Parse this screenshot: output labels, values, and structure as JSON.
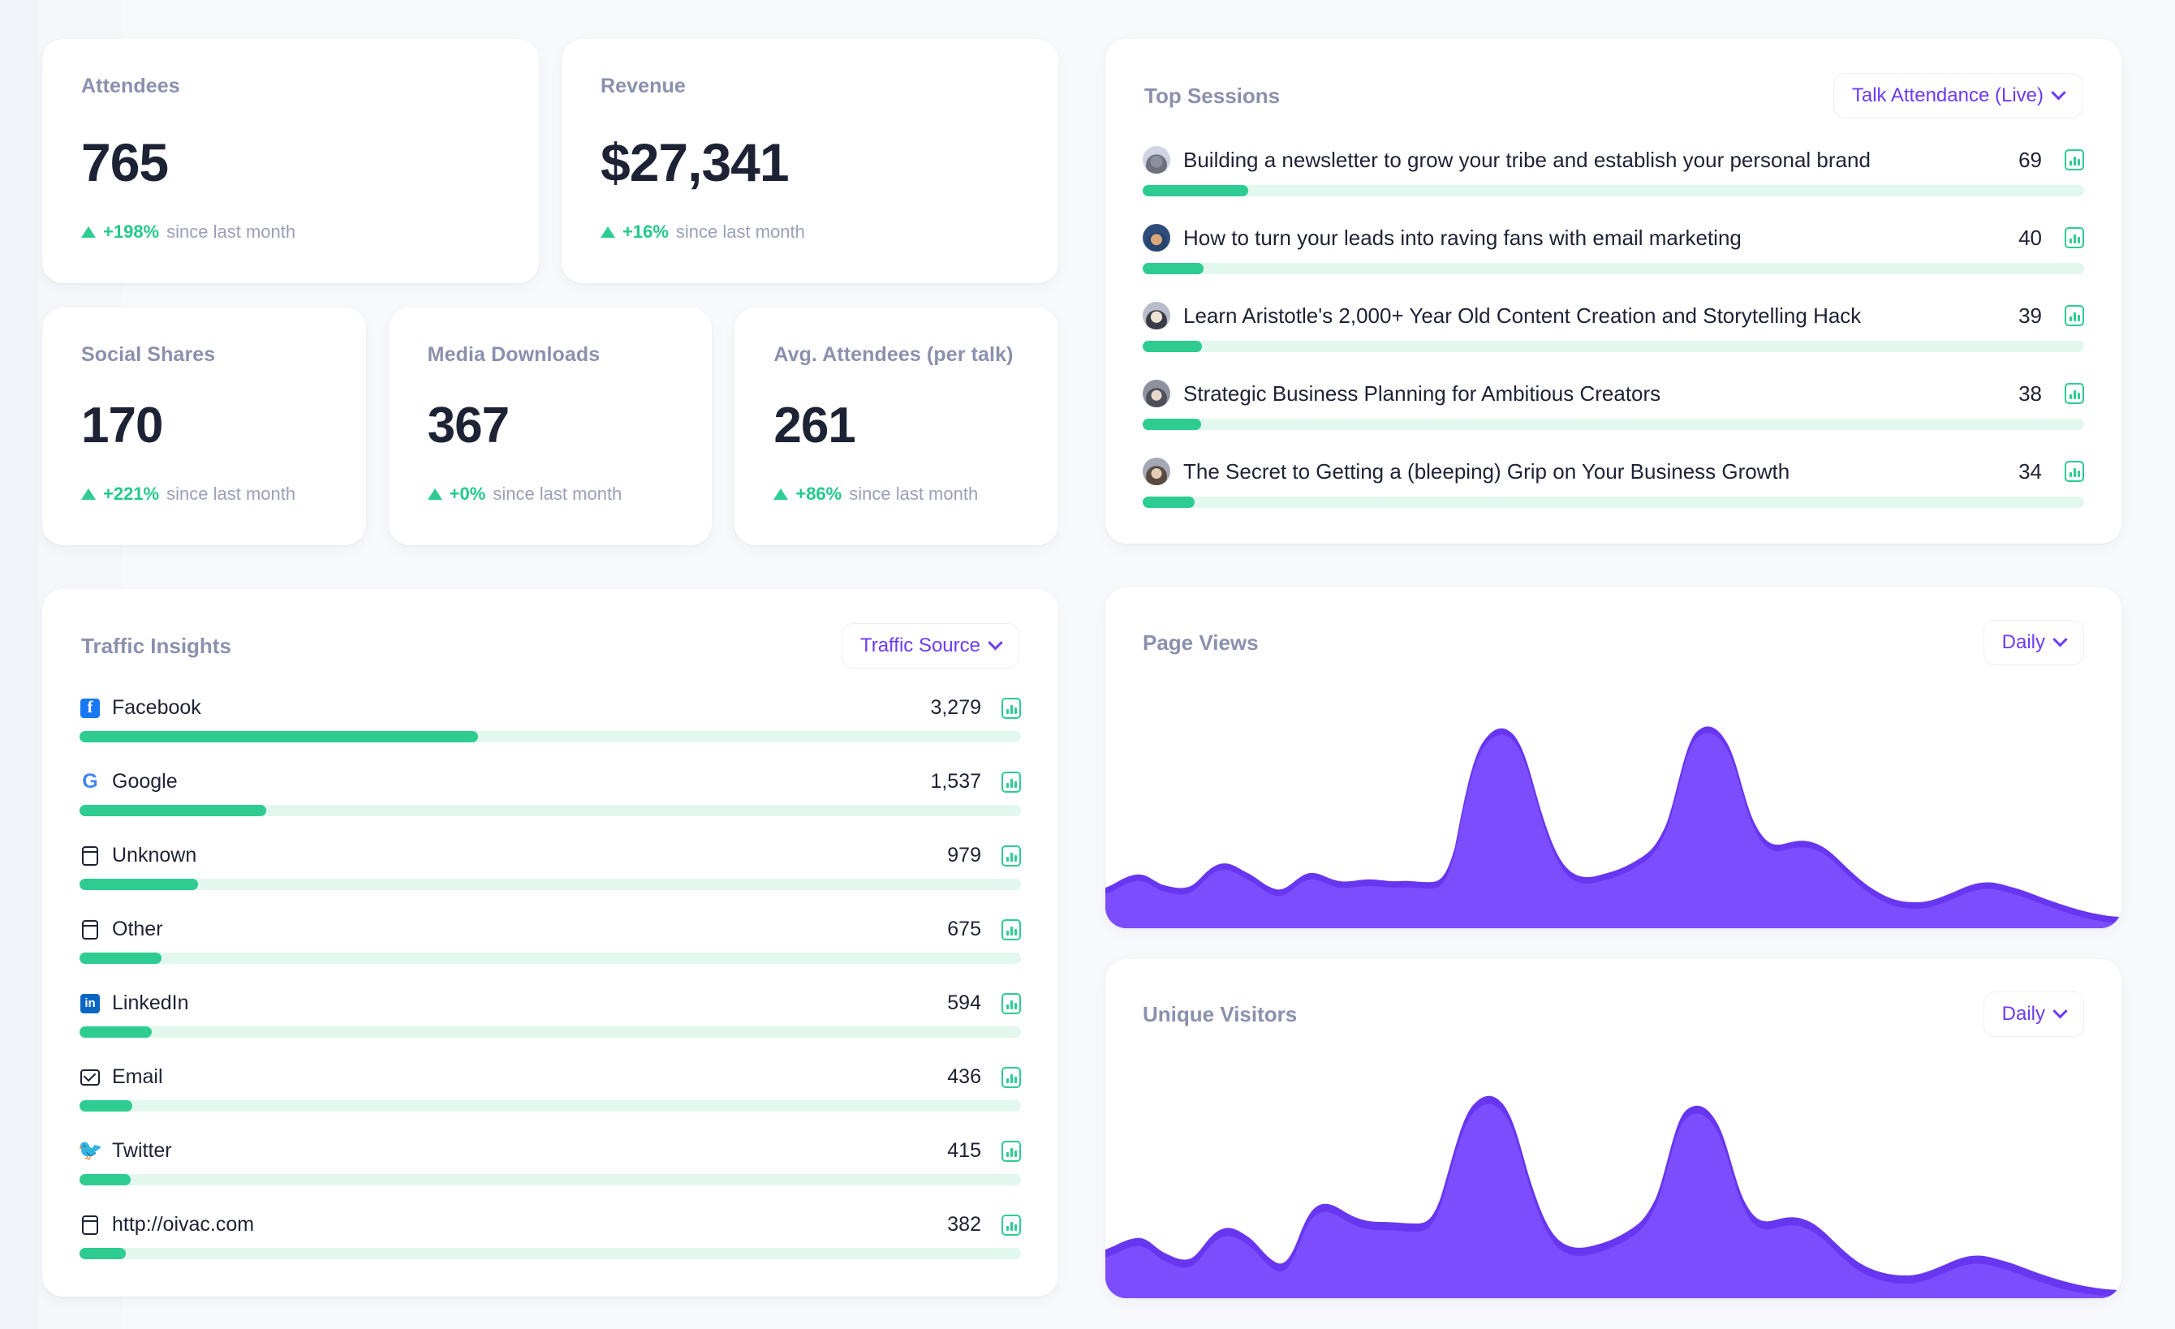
{
  "kpis_primary": [
    {
      "label": "Attendees",
      "value": "765",
      "delta": "+198%",
      "delta_suffix": "since last month"
    },
    {
      "label": "Revenue",
      "value": "$27,341",
      "delta": "+16%",
      "delta_suffix": "since last month"
    }
  ],
  "kpis_secondary": [
    {
      "label": "Social Shares",
      "value": "170",
      "delta": "+221%",
      "delta_suffix": "since last month"
    },
    {
      "label": "Media Downloads",
      "value": "367",
      "delta": "+0%",
      "delta_suffix": "since last month"
    },
    {
      "label": "Avg. Attendees (per talk)",
      "value": "261",
      "delta": "+86%",
      "delta_suffix": "since last month"
    }
  ],
  "top_sessions": {
    "title": "Top Sessions",
    "filter_label": "Talk Attendance (Live)",
    "items": [
      {
        "name": "Building a newsletter to grow your tribe and establish your personal brand",
        "value": "69",
        "pct": 11.2
      },
      {
        "name": "How to turn your leads into raving fans with email marketing",
        "value": "40",
        "pct": 6.5
      },
      {
        "name": "Learn Aristotle's 2,000+ Year Old Content Creation and Storytelling Hack",
        "value": "39",
        "pct": 6.3
      },
      {
        "name": "Strategic Business Planning for Ambitious Creators",
        "value": "38",
        "pct": 6.2
      },
      {
        "name": "The Secret to Getting a (bleeping) Grip on Your Business Growth",
        "value": "34",
        "pct": 5.5
      }
    ]
  },
  "traffic_insights": {
    "title": "Traffic Insights",
    "filter_label": "Traffic Source",
    "items": [
      {
        "name": "Facebook",
        "value": "3,279",
        "pct": 42.3,
        "icon": "facebook-icon"
      },
      {
        "name": "Google",
        "value": "1,537",
        "pct": 19.8,
        "icon": "google-icon"
      },
      {
        "name": "Unknown",
        "value": "979",
        "pct": 12.6,
        "icon": "window-icon"
      },
      {
        "name": "Other",
        "value": "675",
        "pct": 8.7,
        "icon": "window-icon"
      },
      {
        "name": "LinkedIn",
        "value": "594",
        "pct": 7.7,
        "icon": "linkedin-icon"
      },
      {
        "name": "Email",
        "value": "436",
        "pct": 5.6,
        "icon": "mail-icon"
      },
      {
        "name": "Twitter",
        "value": "415",
        "pct": 5.4,
        "icon": "twitter-icon"
      },
      {
        "name": "http://oivac.com",
        "value": "382",
        "pct": 4.9,
        "icon": "window-icon"
      }
    ]
  },
  "page_views": {
    "title": "Page Views",
    "filter_label": "Daily"
  },
  "unique_visitors": {
    "title": "Unique Visitors",
    "filter_label": "Daily"
  },
  "colors": {
    "accent_purple": "#6c3cf5",
    "chart_purple": "#7c4dfd",
    "chart_purple_dark": "#6836f0",
    "success_green": "#2ecc91",
    "track_green": "#e2f7ee",
    "text_dark": "#1e2235",
    "text_muted": "#8b90ad",
    "background": "#f6f7fb"
  },
  "chart_data": [
    {
      "type": "area",
      "title": "Page Views",
      "xlabel": "",
      "ylabel": "",
      "grid": false,
      "legend": "none",
      "x": [
        0,
        1,
        2,
        3,
        4,
        5,
        6,
        7,
        8,
        9,
        10,
        11,
        12,
        13,
        14,
        15,
        16,
        17,
        18,
        19,
        20,
        21,
        22,
        23,
        24,
        25,
        26,
        27,
        28,
        29,
        30,
        31
      ],
      "values": [
        18,
        22,
        12,
        20,
        9,
        6,
        12,
        22,
        31,
        29,
        16,
        10,
        17,
        22,
        22,
        22,
        20,
        21,
        79,
        74,
        50,
        36,
        31,
        30,
        29,
        96,
        83,
        60,
        58,
        57,
        44,
        22,
        10,
        8,
        9,
        14,
        16,
        11,
        6
      ]
    },
    {
      "type": "area",
      "title": "Unique Visitors",
      "xlabel": "",
      "ylabel": "",
      "grid": false,
      "legend": "none",
      "x": [
        0,
        1,
        2,
        3,
        4,
        5,
        6,
        7,
        8,
        9,
        10,
        11,
        12,
        13,
        14,
        15,
        16,
        17,
        18,
        19,
        20,
        21,
        22,
        23,
        24,
        25,
        26,
        27,
        28,
        29,
        30,
        31
      ],
      "values": [
        20,
        24,
        14,
        22,
        10,
        7,
        13,
        26,
        34,
        31,
        17,
        9,
        24,
        34,
        32,
        30,
        27,
        28,
        86,
        78,
        54,
        38,
        33,
        32,
        31,
        92,
        80,
        62,
        60,
        58,
        46,
        24,
        11,
        9,
        10,
        16,
        18,
        12,
        7
      ]
    }
  ]
}
